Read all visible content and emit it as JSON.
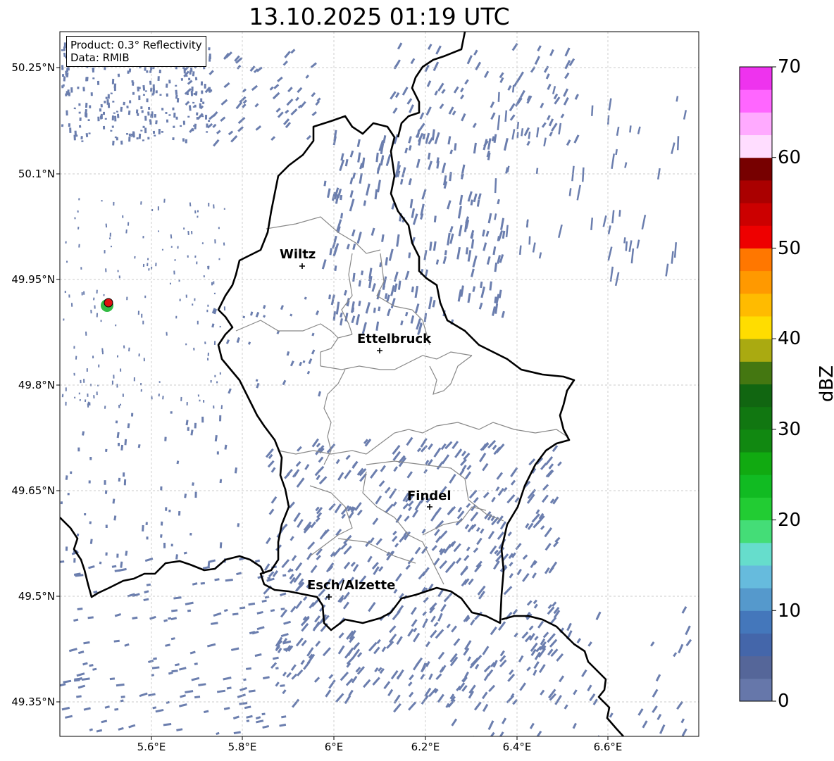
{
  "title": "13.10.2025 01:19 UTC",
  "info_box": {
    "product": "Product: 0.3° Reflectivity",
    "data": "Data: RMIB"
  },
  "lat_ticks": [
    "50.25°N",
    "50.1°N",
    "49.95°N",
    "49.8°N",
    "49.65°N",
    "49.5°N",
    "49.35°N"
  ],
  "lon_ticks": [
    "5.6°E",
    "5.8°E",
    "6°E",
    "6.2°E",
    "6.4°E",
    "6.6°E"
  ],
  "cities": [
    {
      "name": "Wiltz"
    },
    {
      "name": "Ettelbruck"
    },
    {
      "name": "Findel"
    },
    {
      "name": "Esch/Alzette"
    }
  ],
  "colorbar": {
    "label": "dBZ",
    "ticks": [
      "0",
      "10",
      "20",
      "30",
      "40",
      "50",
      "60",
      "70"
    ],
    "range": [
      0,
      70
    ],
    "colors": [
      "#6677aa",
      "#556699",
      "#4466aa",
      "#4477bb",
      "#5599cc",
      "#66bbdd",
      "#66ddcc",
      "#44dd77",
      "#22cc33",
      "#11bb22",
      "#11aa11",
      "#118811",
      "#117711",
      "#116611",
      "#447711",
      "#aaaa11",
      "#ffdd00",
      "#ffbb00",
      "#ff9900",
      "#ff7700",
      "#ee0000",
      "#cc0000",
      "#aa0000",
      "#770000",
      "#ffddff",
      "#ffaaff",
      "#ff66ff",
      "#ee33ee"
    ]
  },
  "colors": {
    "echo": "#6b7eae",
    "border": "#000000",
    "canton": "#888888",
    "radar_site": "#dd1111",
    "radar_clutter": "#33bb44"
  }
}
